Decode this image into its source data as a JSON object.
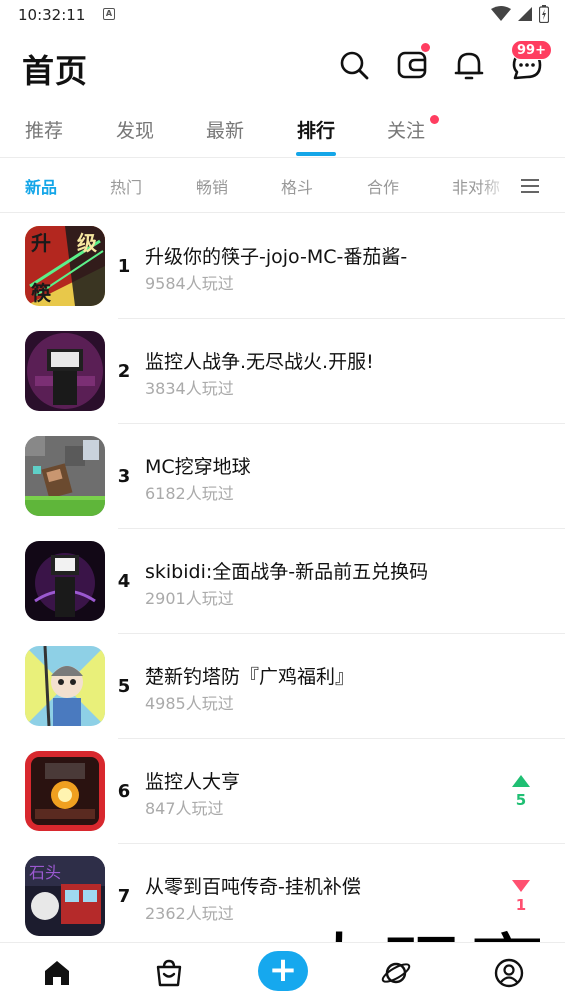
{
  "status_bar": {
    "time": "10:32:11",
    "notif_letter": "A"
  },
  "header": {
    "title": "首页",
    "message_badge": "99+"
  },
  "main_tabs": [
    {
      "label": "推荐",
      "active": false
    },
    {
      "label": "发现",
      "active": false
    },
    {
      "label": "最新",
      "active": false
    },
    {
      "label": "排行",
      "active": true
    },
    {
      "label": "关注",
      "active": false,
      "has_dot": true
    }
  ],
  "sub_tabs": [
    {
      "label": "新品",
      "active": true
    },
    {
      "label": "热门",
      "active": false
    },
    {
      "label": "畅销",
      "active": false
    },
    {
      "label": "格斗",
      "active": false
    },
    {
      "label": "合作",
      "active": false
    },
    {
      "label": "非对称",
      "active": false
    }
  ],
  "games": [
    {
      "rank": "1",
      "title": "升级你的筷子-jojo-MC-番茄酱-",
      "plays": "9584人玩过"
    },
    {
      "rank": "2",
      "title": "监控人战争.无尽战火.开服!",
      "plays": "3834人玩过"
    },
    {
      "rank": "3",
      "title": "MC挖穿地球",
      "plays": "6182人玩过"
    },
    {
      "rank": "4",
      "title": "skibidi:全面战争-新品前五兑换码",
      "plays": "2901人玩过"
    },
    {
      "rank": "5",
      "title": "楚新钓塔防『广鸡福利』",
      "plays": "4985人玩过"
    },
    {
      "rank": "6",
      "title": "监控人大亨",
      "plays": "847人玩过",
      "trend": "up",
      "trend_value": "5"
    },
    {
      "rank": "7",
      "title": "从零到百吨传奇-挂机补偿",
      "plays": "2362人玩过",
      "trend": "down",
      "trend_value": "1"
    }
  ],
  "thumb_texts": {
    "t1_a": "升",
    "t1_b": "级",
    "t1_c": "筷",
    "t7": "石头"
  },
  "watermark": "大玩家",
  "colors": {
    "accent": "#14a6e8",
    "badge": "#ff3d60",
    "up": "#1fbf73",
    "down": "#ff5070"
  },
  "icons": {
    "header": [
      "search-icon",
      "wallet-icon",
      "bell-icon",
      "chat-icon"
    ],
    "bottom_nav": [
      "home-icon",
      "shop-icon",
      "add-icon",
      "planet-icon",
      "profile-icon"
    ]
  }
}
